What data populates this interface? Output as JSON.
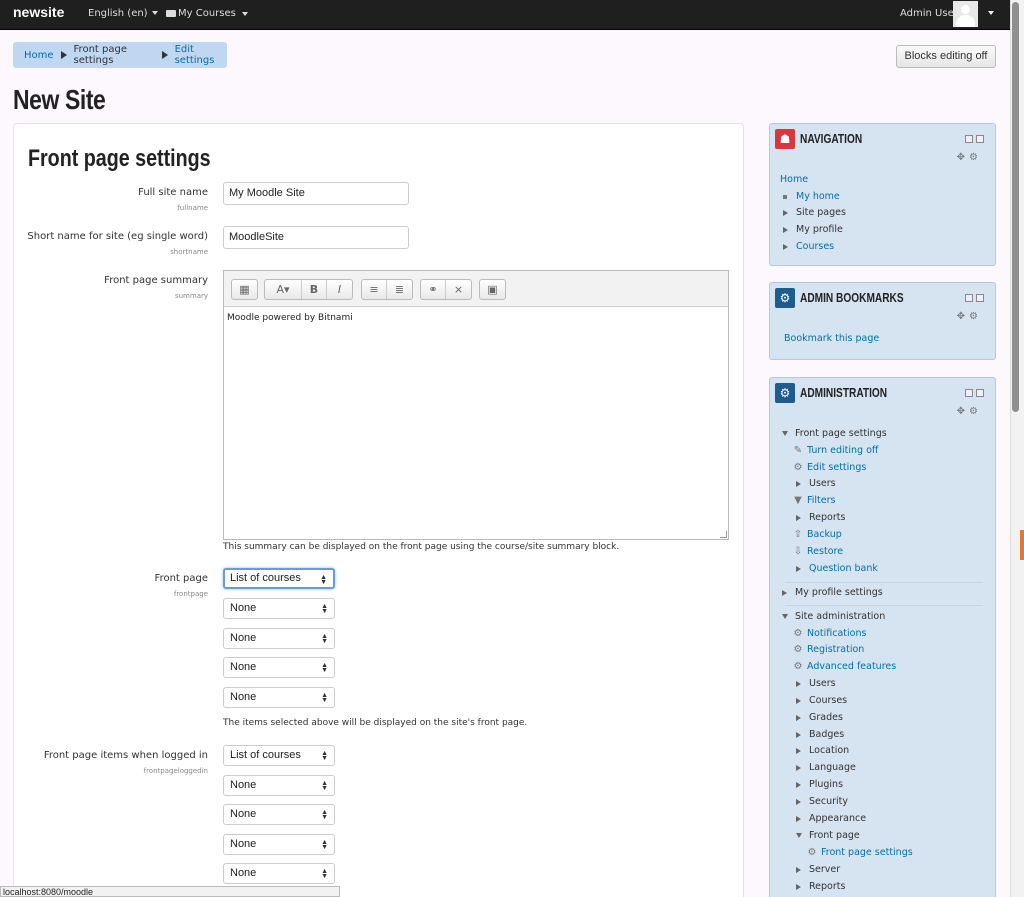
{
  "navbar": {
    "brand": "newsite",
    "language": "English (en)",
    "my_courses": "My Courses",
    "user": "Admin User"
  },
  "breadcrumb": {
    "home": "Home",
    "front_page_settings": "Front page settings",
    "edit_settings": "Edit settings"
  },
  "blocks_editing_button": "Blocks editing off",
  "page_title": "New Site",
  "form": {
    "section_title": "Front page settings",
    "fullname": {
      "label": "Full site name",
      "id": "fullname",
      "value": "My Moodle Site"
    },
    "shortname": {
      "label": "Short name for site (eg single word)",
      "id": "shortname",
      "value": "MoodleSite"
    },
    "summary": {
      "label": "Front page summary",
      "id": "summary",
      "content": "Moodle powered by Bitnami",
      "help": "This summary can be displayed on the front page using the course/site summary block."
    },
    "frontpage": {
      "label": "Front page",
      "id": "frontpage",
      "values": [
        "List of courses",
        "None",
        "None",
        "None",
        "None"
      ],
      "help": "The items selected above will be displayed on the site's front page."
    },
    "frontpageloggedin": {
      "label": "Front page items when logged in",
      "id": "frontpageloggedin",
      "values": [
        "List of courses",
        "None",
        "None",
        "None",
        "None"
      ]
    }
  },
  "editor_toolbar": {
    "icons": [
      "toolbar-toggle-icon",
      "text-style-icon",
      "bold-icon",
      "italic-icon",
      "unordered-list-icon",
      "ordered-list-icon",
      "link-icon",
      "unlink-icon",
      "image-icon"
    ],
    "bold": "B",
    "italic": "I"
  },
  "status_bar": "localhost:8080/moodle",
  "navigation_block": {
    "title": "NAVIGATION",
    "home": "Home",
    "items": [
      "My home",
      "Site pages",
      "My profile",
      "Courses"
    ]
  },
  "bookmarks_block": {
    "title": "ADMIN BOOKMARKS",
    "link": "Bookmark this page"
  },
  "administration_block": {
    "title": "ADMINISTRATION",
    "front_page_settings": "Front page settings",
    "fps_items": [
      "Turn editing off",
      "Edit settings",
      "Users",
      "Filters",
      "Reports",
      "Backup",
      "Restore",
      "Question bank"
    ],
    "my_profile_settings": "My profile settings",
    "site_administration": "Site administration",
    "sa_items": [
      "Notifications",
      "Registration",
      "Advanced features",
      "Users",
      "Courses",
      "Grades",
      "Badges",
      "Location",
      "Language",
      "Plugins",
      "Security",
      "Appearance",
      "Front page"
    ],
    "front_page_child": "Front page settings",
    "sa_tail": [
      "Server",
      "Reports"
    ]
  },
  "colors": {
    "navbar": "#1f1f1f",
    "link": "#0070a8",
    "block_bg": "#d6e3f0",
    "breadcrumb_bg": "#bfd7f0",
    "nav_icon": "#d9363e",
    "admin_icon": "#1d5c8f"
  }
}
